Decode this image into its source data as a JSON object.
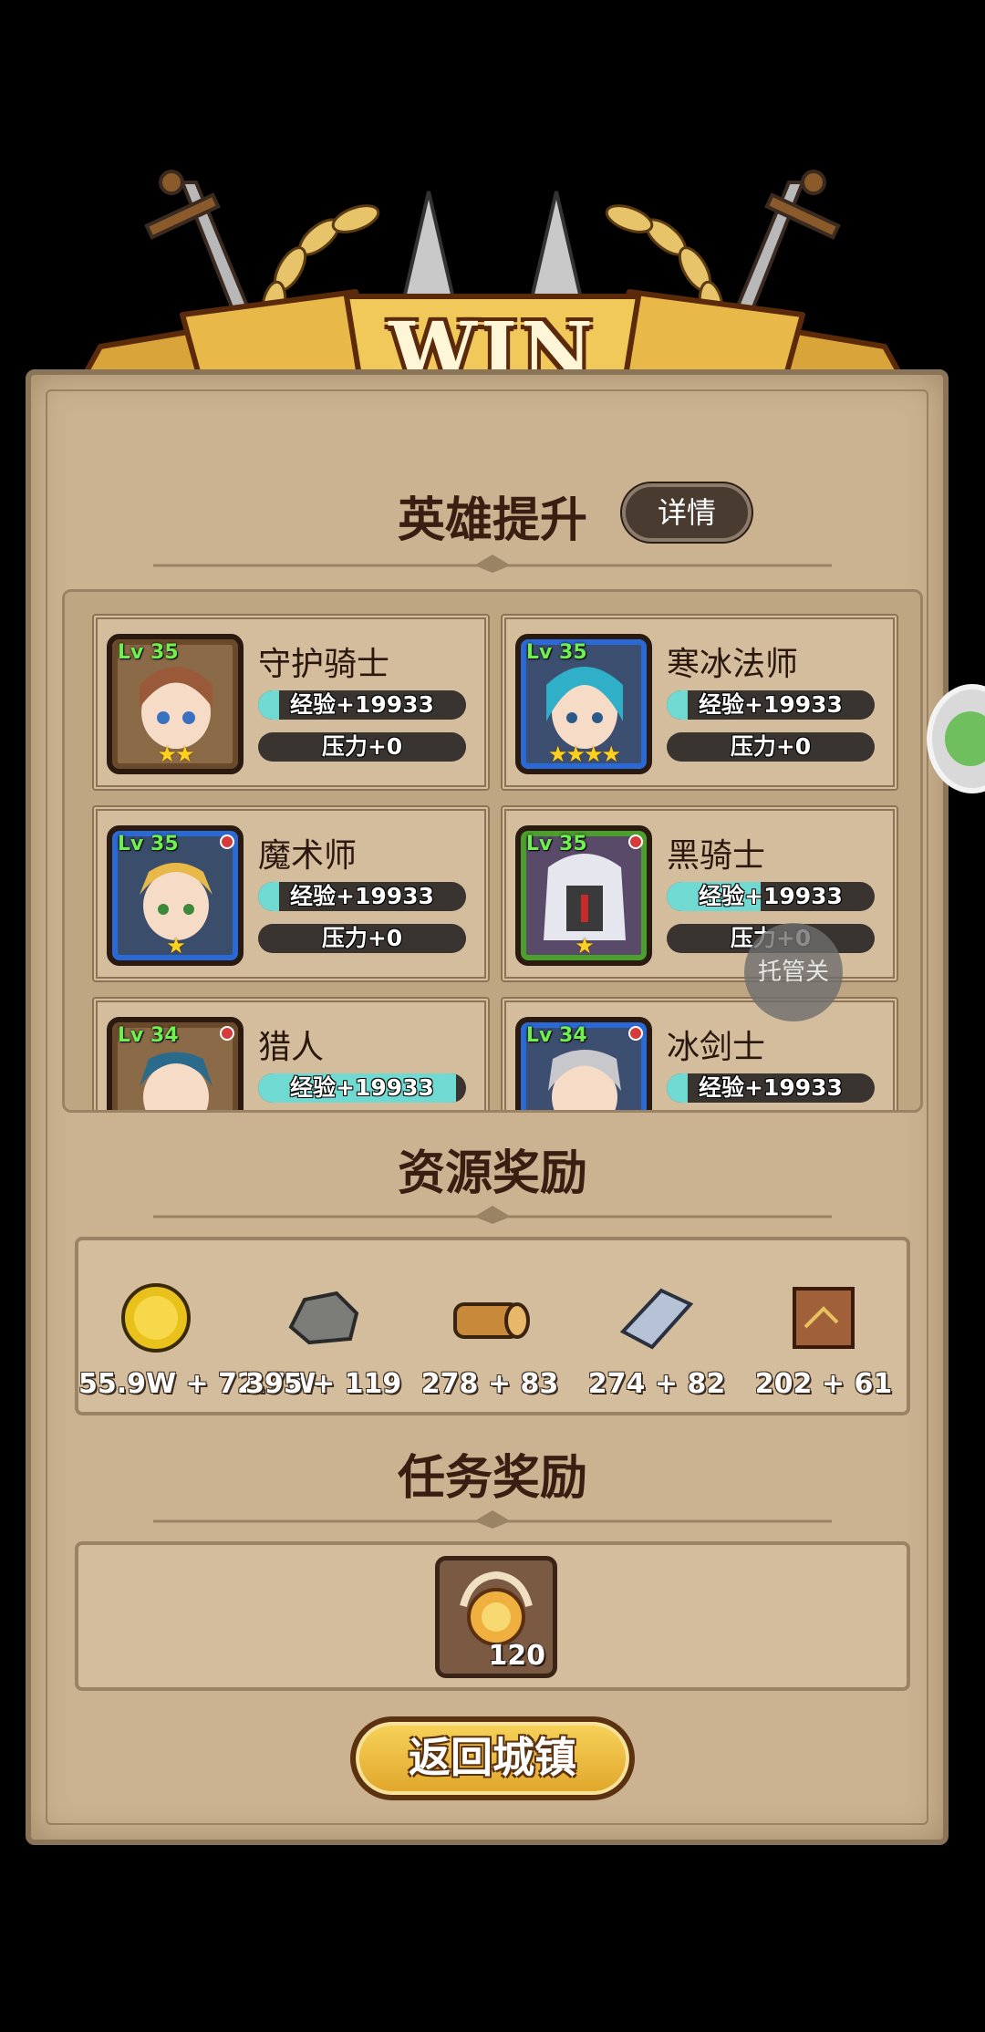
{
  "banner": {
    "title": "WIN"
  },
  "hero_section": {
    "title": "英雄提升",
    "detail_label": "详情",
    "heroes": [
      {
        "name": "守护骑士",
        "level": "Lv 35",
        "exp": "经验+19933",
        "exp_fill": 0.1,
        "pressure": "压力+0",
        "stars": "★★",
        "frame_color": "#6a4a2a",
        "bg_color": "#8b6a48",
        "red_dot": false
      },
      {
        "name": "寒冰法师",
        "level": "Lv 35",
        "exp": "经验+19933",
        "exp_fill": 0.1,
        "pressure": "压力+0",
        "stars": "★★★★",
        "frame_color": "#2a6ad8",
        "bg_color": "#3d4f70",
        "red_dot": false
      },
      {
        "name": "魔术师",
        "level": "Lv 35",
        "exp": "经验+19933",
        "exp_fill": 0.1,
        "pressure": "压力+0",
        "stars": "★",
        "frame_color": "#2a6ad8",
        "bg_color": "#3a4e6c",
        "red_dot": true
      },
      {
        "name": "黑骑士",
        "level": "Lv 35",
        "exp": "经验+19933",
        "exp_fill": 0.45,
        "pressure": "压力+0",
        "stars": "★",
        "frame_color": "#4aa02a",
        "bg_color": "#5a4a6a",
        "red_dot": true
      },
      {
        "name": "猎人",
        "level": "Lv 34",
        "exp": "经验+19933",
        "exp_fill": 0.95,
        "pressure": "",
        "stars": "",
        "frame_color": "#6a4a2a",
        "bg_color": "#8b6a48",
        "red_dot": true
      },
      {
        "name": "冰剑士",
        "level": "Lv 34",
        "exp": "经验+19933",
        "exp_fill": 0.1,
        "pressure": "",
        "stars": "",
        "frame_color": "#2a6ad8",
        "bg_color": "#3d4f70",
        "red_dot": true
      }
    ]
  },
  "resource_section": {
    "title": "资源奖励",
    "items": [
      {
        "icon": "gold-coin-icon",
        "value": "55.9W + 72.7W"
      },
      {
        "icon": "stone-icon",
        "value": "395 + 119"
      },
      {
        "icon": "wood-log-icon",
        "value": "278 + 83"
      },
      {
        "icon": "iron-ingot-icon",
        "value": "274 + 82"
      },
      {
        "icon": "leather-icon",
        "value": "202 + 61"
      }
    ]
  },
  "task_section": {
    "title": "任务奖励",
    "reward": {
      "icon": "laurel-medal-icon",
      "count": "120"
    }
  },
  "return_button": {
    "label": "返回城镇"
  },
  "floating": {
    "hosting_label": "托管关"
  }
}
